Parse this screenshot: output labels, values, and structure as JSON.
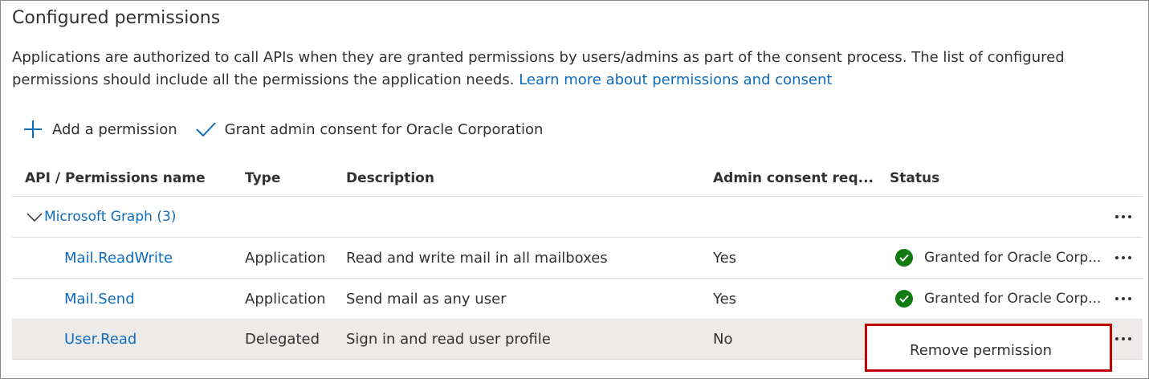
{
  "title": "Configured permissions",
  "description": {
    "text": "Applications are authorized to call APIs when they are granted permissions by users/admins as part of the consent process. The list of configured permissions should include all the permissions the application needs.",
    "link": "Learn more about permissions and consent"
  },
  "toolbar": {
    "add_label": "Add a permission",
    "grant_label": "Grant admin consent for Oracle Corporation"
  },
  "table": {
    "headers": {
      "api": "API / Permissions name",
      "type": "Type",
      "description": "Description",
      "admin": "Admin consent req...",
      "status": "Status"
    },
    "group": {
      "label": "Microsoft Graph (3)"
    },
    "rows": [
      {
        "name": "Mail.ReadWrite",
        "type": "Application",
        "description": "Read and write mail in all mailboxes",
        "admin": "Yes",
        "status": "Granted for Oracle Corp..."
      },
      {
        "name": "Mail.Send",
        "type": "Application",
        "description": "Send mail as any user",
        "admin": "Yes",
        "status": "Granted for Oracle Corp..."
      },
      {
        "name": "User.Read",
        "type": "Delegated",
        "description": "Sign in and read user profile",
        "admin": "No",
        "status": ""
      }
    ]
  },
  "context_menu": {
    "remove_label": "Remove permission"
  },
  "colors": {
    "link": "#0f6cbd",
    "granted": "#107c10",
    "highlight": "#c00000"
  },
  "icons": {
    "add": "plus-icon",
    "grant": "checkmark-icon",
    "expand": "chevron-down-icon",
    "status": "check-circle-icon",
    "more": "more-icon"
  }
}
